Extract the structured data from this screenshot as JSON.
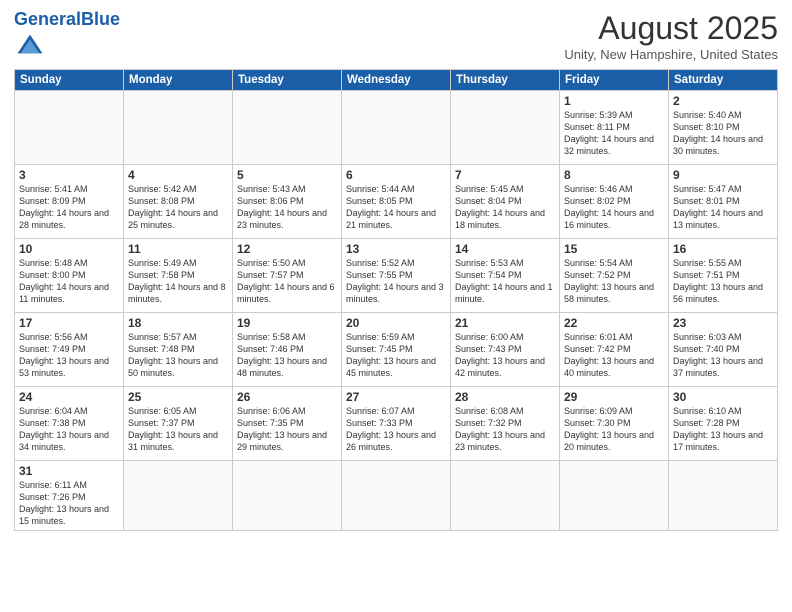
{
  "header": {
    "logo_general": "General",
    "logo_blue": "Blue",
    "month": "August 2025",
    "location": "Unity, New Hampshire, United States"
  },
  "days_of_week": [
    "Sunday",
    "Monday",
    "Tuesday",
    "Wednesday",
    "Thursday",
    "Friday",
    "Saturday"
  ],
  "weeks": [
    [
      {
        "day": "",
        "content": ""
      },
      {
        "day": "",
        "content": ""
      },
      {
        "day": "",
        "content": ""
      },
      {
        "day": "",
        "content": ""
      },
      {
        "day": "",
        "content": ""
      },
      {
        "day": "1",
        "content": "Sunrise: 5:39 AM\nSunset: 8:11 PM\nDaylight: 14 hours and 32 minutes."
      },
      {
        "day": "2",
        "content": "Sunrise: 5:40 AM\nSunset: 8:10 PM\nDaylight: 14 hours and 30 minutes."
      }
    ],
    [
      {
        "day": "3",
        "content": "Sunrise: 5:41 AM\nSunset: 8:09 PM\nDaylight: 14 hours and 28 minutes."
      },
      {
        "day": "4",
        "content": "Sunrise: 5:42 AM\nSunset: 8:08 PM\nDaylight: 14 hours and 25 minutes."
      },
      {
        "day": "5",
        "content": "Sunrise: 5:43 AM\nSunset: 8:06 PM\nDaylight: 14 hours and 23 minutes."
      },
      {
        "day": "6",
        "content": "Sunrise: 5:44 AM\nSunset: 8:05 PM\nDaylight: 14 hours and 21 minutes."
      },
      {
        "day": "7",
        "content": "Sunrise: 5:45 AM\nSunset: 8:04 PM\nDaylight: 14 hours and 18 minutes."
      },
      {
        "day": "8",
        "content": "Sunrise: 5:46 AM\nSunset: 8:02 PM\nDaylight: 14 hours and 16 minutes."
      },
      {
        "day": "9",
        "content": "Sunrise: 5:47 AM\nSunset: 8:01 PM\nDaylight: 14 hours and 13 minutes."
      }
    ],
    [
      {
        "day": "10",
        "content": "Sunrise: 5:48 AM\nSunset: 8:00 PM\nDaylight: 14 hours and 11 minutes."
      },
      {
        "day": "11",
        "content": "Sunrise: 5:49 AM\nSunset: 7:58 PM\nDaylight: 14 hours and 8 minutes."
      },
      {
        "day": "12",
        "content": "Sunrise: 5:50 AM\nSunset: 7:57 PM\nDaylight: 14 hours and 6 minutes."
      },
      {
        "day": "13",
        "content": "Sunrise: 5:52 AM\nSunset: 7:55 PM\nDaylight: 14 hours and 3 minutes."
      },
      {
        "day": "14",
        "content": "Sunrise: 5:53 AM\nSunset: 7:54 PM\nDaylight: 14 hours and 1 minute."
      },
      {
        "day": "15",
        "content": "Sunrise: 5:54 AM\nSunset: 7:52 PM\nDaylight: 13 hours and 58 minutes."
      },
      {
        "day": "16",
        "content": "Sunrise: 5:55 AM\nSunset: 7:51 PM\nDaylight: 13 hours and 56 minutes."
      }
    ],
    [
      {
        "day": "17",
        "content": "Sunrise: 5:56 AM\nSunset: 7:49 PM\nDaylight: 13 hours and 53 minutes."
      },
      {
        "day": "18",
        "content": "Sunrise: 5:57 AM\nSunset: 7:48 PM\nDaylight: 13 hours and 50 minutes."
      },
      {
        "day": "19",
        "content": "Sunrise: 5:58 AM\nSunset: 7:46 PM\nDaylight: 13 hours and 48 minutes."
      },
      {
        "day": "20",
        "content": "Sunrise: 5:59 AM\nSunset: 7:45 PM\nDaylight: 13 hours and 45 minutes."
      },
      {
        "day": "21",
        "content": "Sunrise: 6:00 AM\nSunset: 7:43 PM\nDaylight: 13 hours and 42 minutes."
      },
      {
        "day": "22",
        "content": "Sunrise: 6:01 AM\nSunset: 7:42 PM\nDaylight: 13 hours and 40 minutes."
      },
      {
        "day": "23",
        "content": "Sunrise: 6:03 AM\nSunset: 7:40 PM\nDaylight: 13 hours and 37 minutes."
      }
    ],
    [
      {
        "day": "24",
        "content": "Sunrise: 6:04 AM\nSunset: 7:38 PM\nDaylight: 13 hours and 34 minutes."
      },
      {
        "day": "25",
        "content": "Sunrise: 6:05 AM\nSunset: 7:37 PM\nDaylight: 13 hours and 31 minutes."
      },
      {
        "day": "26",
        "content": "Sunrise: 6:06 AM\nSunset: 7:35 PM\nDaylight: 13 hours and 29 minutes."
      },
      {
        "day": "27",
        "content": "Sunrise: 6:07 AM\nSunset: 7:33 PM\nDaylight: 13 hours and 26 minutes."
      },
      {
        "day": "28",
        "content": "Sunrise: 6:08 AM\nSunset: 7:32 PM\nDaylight: 13 hours and 23 minutes."
      },
      {
        "day": "29",
        "content": "Sunrise: 6:09 AM\nSunset: 7:30 PM\nDaylight: 13 hours and 20 minutes."
      },
      {
        "day": "30",
        "content": "Sunrise: 6:10 AM\nSunset: 7:28 PM\nDaylight: 13 hours and 17 minutes."
      }
    ],
    [
      {
        "day": "31",
        "content": "Sunrise: 6:11 AM\nSunset: 7:26 PM\nDaylight: 13 hours and 15 minutes."
      },
      {
        "day": "",
        "content": ""
      },
      {
        "day": "",
        "content": ""
      },
      {
        "day": "",
        "content": ""
      },
      {
        "day": "",
        "content": ""
      },
      {
        "day": "",
        "content": ""
      },
      {
        "day": "",
        "content": ""
      }
    ]
  ]
}
